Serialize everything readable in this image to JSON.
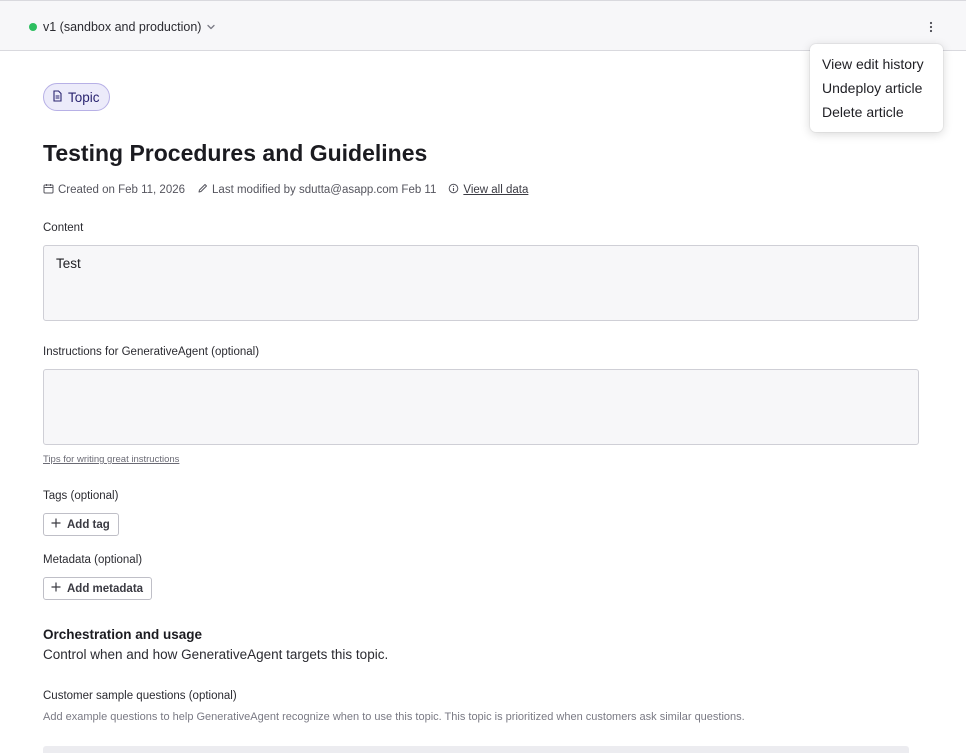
{
  "topbar": {
    "version_label": "v1 (sandbox and production)",
    "status_color": "#2dbe60"
  },
  "menu": {
    "items": [
      {
        "label": "View edit history"
      },
      {
        "label": "Undeploy article"
      },
      {
        "label": "Delete article"
      }
    ]
  },
  "article": {
    "type_chip": "Topic",
    "title": "Testing Procedures and Guidelines",
    "meta": {
      "created": "Created on Feb 11, 2026",
      "modified": "Last modified by sdutta@asapp.com Feb 11",
      "view_all": "View all data"
    }
  },
  "content": {
    "label": "Content",
    "value": "Test"
  },
  "instructions": {
    "label": "Instructions for GenerativeAgent (optional)",
    "value": "",
    "tips_link": "Tips for writing great instructions"
  },
  "tags": {
    "label": "Tags (optional)",
    "add_button": "Add tag"
  },
  "metadata": {
    "label": "Metadata (optional)",
    "add_button": "Add metadata"
  },
  "orchestration": {
    "title": "Orchestration and usage",
    "description": "Control when and how GenerativeAgent targets this topic."
  },
  "sample_questions": {
    "label": "Customer sample questions (optional)",
    "hint": "Add example questions to help GenerativeAgent recognize when to use this topic. This topic is prioritized when customers ask similar questions."
  },
  "icons": {
    "version_chevron": "chevron-down-icon",
    "more": "kebab-menu-icon",
    "chip": "document-icon",
    "created": "calendar-icon",
    "modified": "pencil-icon",
    "view_all": "info-icon",
    "add": "plus-icon"
  }
}
